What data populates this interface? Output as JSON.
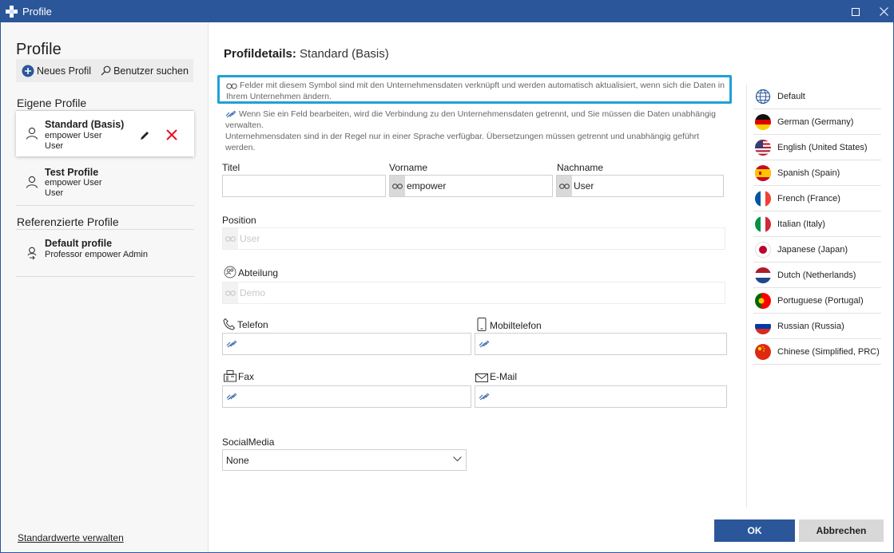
{
  "window": {
    "title": "Profile"
  },
  "sidebar": {
    "title": "Profile",
    "toolbar": {
      "new_profile": "Neues Profil",
      "search_user": "Benutzer suchen"
    },
    "own_section": "Eigene Profile",
    "own_profiles": [
      {
        "name": "Standard (Basis)",
        "line1": "empower User",
        "line2": "User"
      },
      {
        "name": "Test Profile",
        "line1": "empower User",
        "line2": "User"
      }
    ],
    "ref_section": "Referenzierte Profile",
    "ref_profiles": [
      {
        "name": "Default profile",
        "line1": "Professor empower Admin"
      }
    ],
    "footer_link": "Standardwerte verwalten"
  },
  "main": {
    "title_label": "Profildetails:",
    "title_value": "Standard (Basis)",
    "notice_linked": "Felder mit diesem Symbol sind mit den Unternehmensdaten verknüpft und werden automatisch aktualisiert, wenn sich die Daten in Ihrem Unternehmen ändern.",
    "notice_unlinked_1": "Wenn Sie ein Feld bearbeiten, wird die Verbindung zu den Unternehmensdaten getrennt, und Sie müssen die Daten unabhängig verwalten.",
    "notice_unlinked_2": "Unternehmensdaten sind in der Regel nur in einer Sprache verfügbar. Übersetzungen müssen getrennt und unabhängig geführt werden.",
    "fields": {
      "titel": {
        "label": "Titel",
        "value": ""
      },
      "vorname": {
        "label": "Vorname",
        "value": "empower"
      },
      "nachname": {
        "label": "Nachname",
        "value": "User"
      },
      "position": {
        "label": "Position",
        "value": "User"
      },
      "abteilung": {
        "label": "Abteilung",
        "value": "Demo"
      },
      "telefon": {
        "label": "Telefon",
        "value": ""
      },
      "mobiltelefon": {
        "label": "Mobiltelefon",
        "value": ""
      },
      "fax": {
        "label": "Fax",
        "value": ""
      },
      "email": {
        "label": "E-Mail",
        "value": ""
      },
      "socialmedia": {
        "label": "SocialMedia",
        "value": "None"
      }
    }
  },
  "languages": [
    {
      "label": "Default",
      "icon": "globe-icon"
    },
    {
      "label": "German (Germany)",
      "icon": "flag-de-icon"
    },
    {
      "label": "English (United States)",
      "icon": "flag-us-icon"
    },
    {
      "label": "Spanish (Spain)",
      "icon": "flag-es-icon"
    },
    {
      "label": "French (France)",
      "icon": "flag-fr-icon"
    },
    {
      "label": "Italian (Italy)",
      "icon": "flag-it-icon"
    },
    {
      "label": "Japanese (Japan)",
      "icon": "flag-jp-icon"
    },
    {
      "label": "Dutch (Netherlands)",
      "icon": "flag-nl-icon"
    },
    {
      "label": "Portuguese (Portugal)",
      "icon": "flag-pt-icon"
    },
    {
      "label": "Russian (Russia)",
      "icon": "flag-ru-icon"
    },
    {
      "label": "Chinese (Simplified, PRC)",
      "icon": "flag-cn-icon"
    }
  ],
  "buttons": {
    "ok": "OK",
    "cancel": "Abbrechen"
  },
  "colors": {
    "accent": "#2b579a",
    "highlight_border": "#1fa0d8",
    "delete": "#e81123"
  }
}
